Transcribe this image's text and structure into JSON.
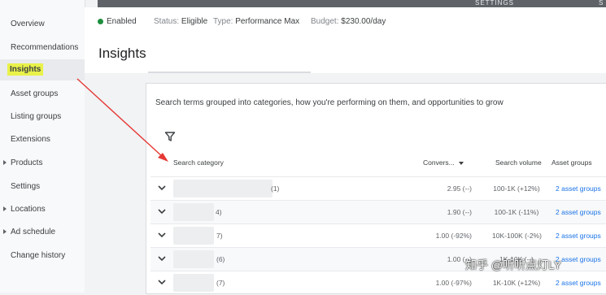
{
  "top_strip": {
    "text": "SETTINGS",
    "text2": "S"
  },
  "sidebar": {
    "items": [
      {
        "label": "Overview"
      },
      {
        "label": "Recommendations"
      },
      {
        "label": "Insights"
      },
      {
        "label": "Asset groups"
      },
      {
        "label": "Listing groups"
      },
      {
        "label": "Extensions"
      },
      {
        "label": "Products"
      },
      {
        "label": "Settings"
      },
      {
        "label": "Locations"
      },
      {
        "label": "Ad schedule"
      },
      {
        "label": "Change history"
      }
    ]
  },
  "status": {
    "enabled": "Enabled",
    "status_label": "Status:",
    "status_value": "Eligible",
    "type_label": "Type:",
    "type_value": "Performance Max",
    "budget_label": "Budget:",
    "budget_value": "$230.00/day"
  },
  "header": {
    "title": "Insights"
  },
  "card": {
    "description": "Search terms grouped into categories, how you're performing on them, and opportunities to grow",
    "columns": {
      "category": "Search category",
      "conversions": "Convers...",
      "volume": "Search volume",
      "asset_groups": "Asset groups"
    },
    "rows": [
      {
        "count": "(1)",
        "conv": "2.95 (--)",
        "volume": "100-1K (+12%)",
        "assets": "2 asset groups"
      },
      {
        "count": "4)",
        "conv": "1.90 (--)",
        "volume": "100-1K (-11%)",
        "assets": "2 asset groups"
      },
      {
        "count": "7)",
        "conv": "1.00 (-92%)",
        "volume": "10K-100K (-2%)",
        "assets": "2 asset groups"
      },
      {
        "count": "(6)",
        "conv": "1.00 (--)",
        "volume": "1K-10K (--)",
        "assets": "2 asset groups"
      },
      {
        "count": "(7)",
        "conv": "1.00 (-97%)",
        "volume": "1K-10K (+12%)",
        "assets": "2 asset groups"
      }
    ]
  },
  "watermark": {
    "text": "知乎 @听听点灯LY"
  }
}
